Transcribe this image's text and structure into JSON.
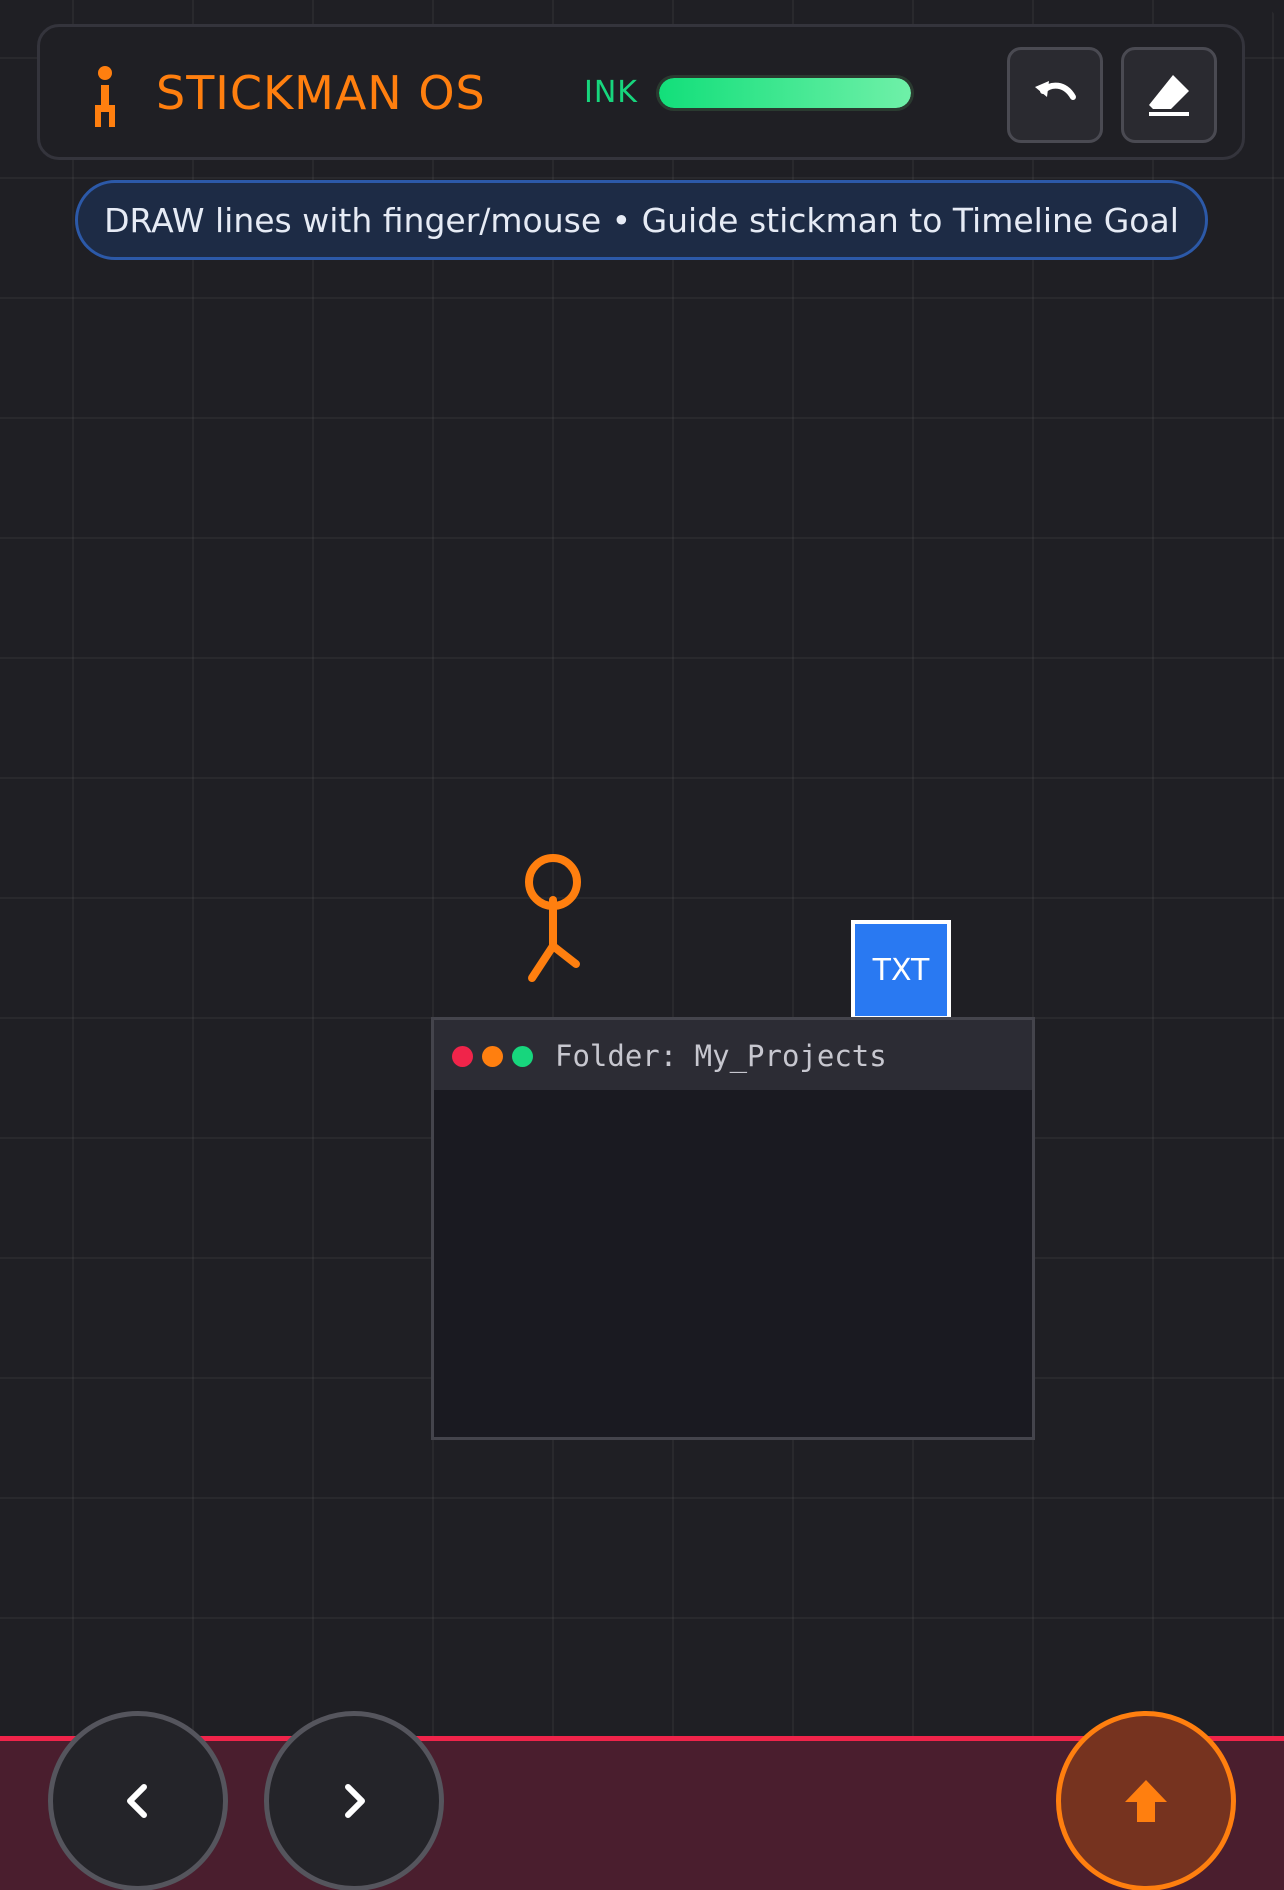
{
  "app": {
    "title": "STICKMAN OS",
    "logo_icon": "stickman-figure-icon",
    "accent_color": "#ff7f0f"
  },
  "ink": {
    "label": "INK",
    "level_percent": 100,
    "color": "#17d67d"
  },
  "toolbar": {
    "undo_icon": "undo-arrow-icon",
    "eraser_icon": "eraser-icon"
  },
  "hint": {
    "text": "DRAW lines with finger/mouse • Guide stickman to Timeline Goal"
  },
  "scene": {
    "player_icon": "stickman-player-icon",
    "file": {
      "label": "TXT",
      "color": "#2979f2"
    },
    "folder": {
      "title": "Folder: My_Projects",
      "dots": [
        "#f0244a",
        "#ff7f0f",
        "#17d67d"
      ]
    }
  },
  "controls": {
    "left_icon": "chevron-left-icon",
    "right_icon": "chevron-right-icon",
    "jump_icon": "arrow-up-icon",
    "goal_color": "#f0244a"
  }
}
